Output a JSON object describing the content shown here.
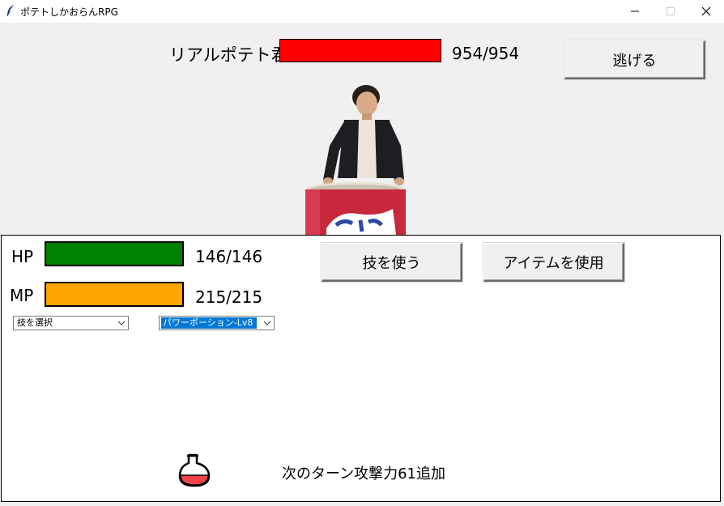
{
  "window": {
    "title": "ポテトしかおらんRPG",
    "icon": "feather-icon"
  },
  "enemy": {
    "name": "リアルポテト君",
    "hp_text": "954/954",
    "hp_fraction": 1.0,
    "bar_color": "#ff0000"
  },
  "buttons": {
    "escape": "逃げる",
    "use_skill": "技を使う",
    "use_item": "アイテムを使用"
  },
  "player": {
    "hp_label": "HP",
    "hp_text": "146/146",
    "hp_color": "#008000",
    "mp_label": "MP",
    "mp_text": "215/215",
    "mp_color": "#ffa500"
  },
  "selects": {
    "skill_selected": "技を選択",
    "item_selected": "パワーポーション-Lv8"
  },
  "message": {
    "text": "次のターン攻撃力61追加",
    "icon": "potion-icon"
  }
}
